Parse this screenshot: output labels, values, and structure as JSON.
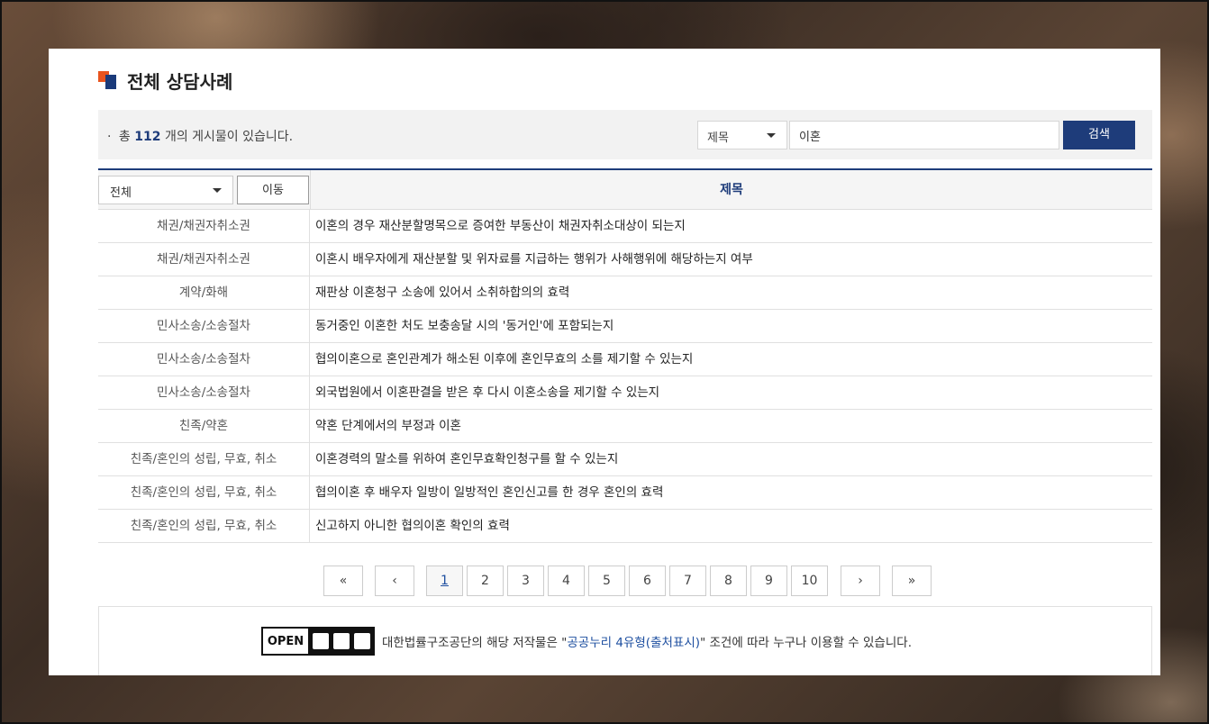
{
  "heading": {
    "title": "전체 상담사례"
  },
  "search": {
    "total_prefix": "총",
    "total_count": "112",
    "total_suffix": "개의 게시물이 있습니다.",
    "field_selected": "제목",
    "query": "이혼",
    "button_label": "검색"
  },
  "table": {
    "category_selected": "전체",
    "move_label": "이동",
    "title_header": "제목",
    "rows": [
      {
        "category": "채권/채권자취소권",
        "title": "이혼의 경우 재산분할명목으로 증여한 부동산이 채권자취소대상이 되는지"
      },
      {
        "category": "채권/채권자취소권",
        "title": "이혼시 배우자에게 재산분할 및 위자료를 지급하는 행위가 사해행위에 해당하는지 여부"
      },
      {
        "category": "계약/화해",
        "title": "재판상 이혼청구 소송에 있어서 소취하합의의 효력"
      },
      {
        "category": "민사소송/소송절차",
        "title": "동거중인 이혼한 처도 보충송달 시의 '동거인'에 포함되는지"
      },
      {
        "category": "민사소송/소송절차",
        "title": "협의이혼으로 혼인관계가 해소된 이후에 혼인무효의 소를 제기할 수 있는지"
      },
      {
        "category": "민사소송/소송절차",
        "title": "외국법원에서 이혼판결을 받은 후 다시 이혼소송을 제기할 수 있는지"
      },
      {
        "category": "친족/약혼",
        "title": "약혼 단계에서의 부정과 이혼"
      },
      {
        "category": "친족/혼인의 성립, 무효, 취소",
        "title": "이혼경력의 말소를 위하여 혼인무효확인청구를 할 수 있는지"
      },
      {
        "category": "친족/혼인의 성립, 무효, 취소",
        "title": "협의이혼 후 배우자 일방이 일방적인 혼인신고를 한 경우 혼인의 효력"
      },
      {
        "category": "친족/혼인의 성립, 무효, 취소",
        "title": "신고하지 아니한 협의이혼 확인의 효력"
      }
    ]
  },
  "pagination": {
    "first": "«",
    "prev": "‹",
    "pages": [
      "1",
      "2",
      "3",
      "4",
      "5",
      "6",
      "7",
      "8",
      "9",
      "10"
    ],
    "current": "1",
    "next": "›",
    "last": "»"
  },
  "license": {
    "badge_text": "OPEN",
    "text_before": "대한법률구조공단의 해당 저작물은 \"",
    "link_text": "공공누리 4유형(출처표시)",
    "text_after": "\" 조건에 따라 누구나 이용할 수 있습니다."
  }
}
